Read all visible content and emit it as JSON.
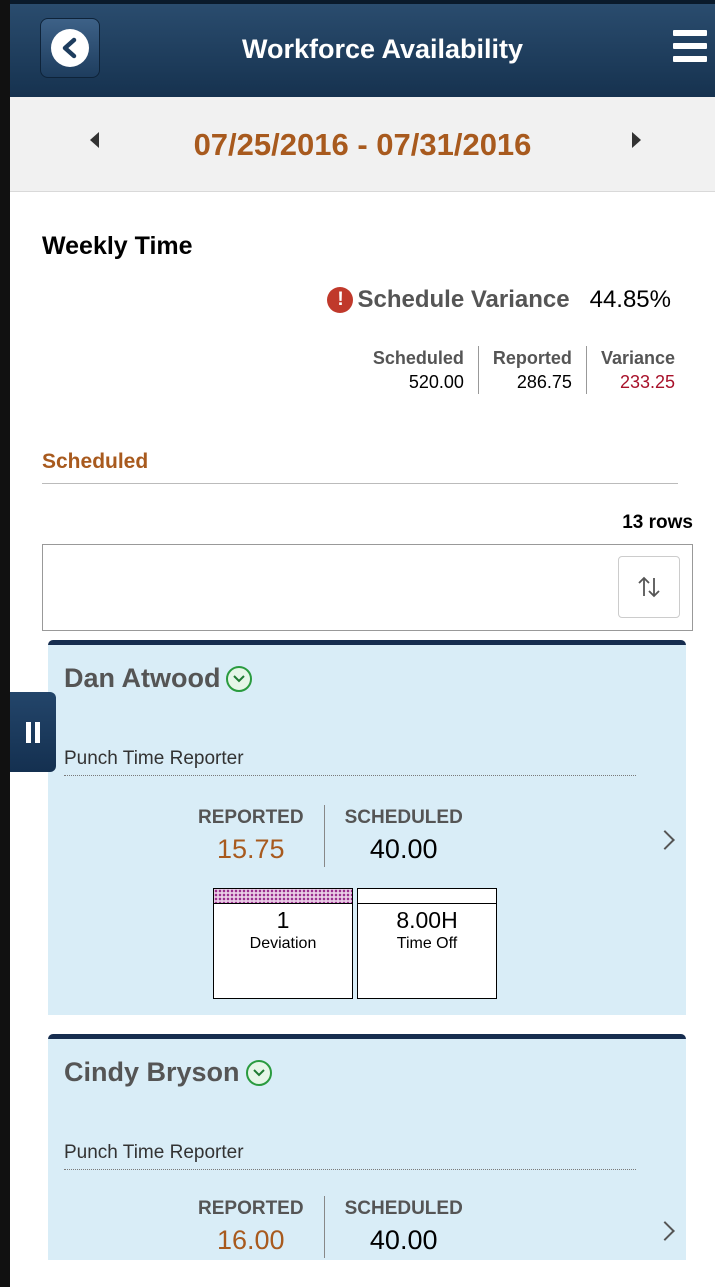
{
  "header": {
    "title": "Workforce Availability"
  },
  "date_nav": {
    "range": "07/25/2016 - 07/31/2016"
  },
  "weekly": {
    "title": "Weekly Time",
    "variance_label": "Schedule Variance",
    "variance_value": "44.85%",
    "stats": [
      {
        "label": "Scheduled",
        "value": "520.00"
      },
      {
        "label": "Reported",
        "value": "286.75"
      },
      {
        "label": "Variance",
        "value": "233.25"
      }
    ]
  },
  "section": {
    "title": "Scheduled",
    "row_count": "13 rows"
  },
  "employees": [
    {
      "name": "Dan Atwood",
      "role": "Punch Time Reporter",
      "reported_label": "REPORTED",
      "reported_value": "15.75",
      "scheduled_label": "SCHEDULED",
      "scheduled_value": "40.00",
      "tiles": [
        {
          "value": "1",
          "label": "Deviation"
        },
        {
          "value": "8.00H",
          "label": "Time Off"
        }
      ]
    },
    {
      "name": "Cindy Bryson",
      "role": "Punch Time Reporter",
      "reported_label": "REPORTED",
      "reported_value": "16.00",
      "scheduled_label": "SCHEDULED",
      "scheduled_value": "40.00"
    }
  ],
  "colors": {
    "header_bg": "#1e3d5e",
    "accent_orange": "#a85a1e",
    "variance_red": "#a8112a",
    "card_bg": "#d9edf7",
    "warning_red": "#c0392b"
  },
  "icons": {
    "back": "back-arrow-icon",
    "menu": "hamburger-menu-icon",
    "prev": "triangle-left-icon",
    "next": "triangle-right-icon",
    "warning": "exclamation-circle-icon",
    "sort": "sort-arrows-icon",
    "expand": "chevron-down-circle-icon",
    "drill": "chevron-right-icon",
    "side_tab": "pause-icon"
  }
}
